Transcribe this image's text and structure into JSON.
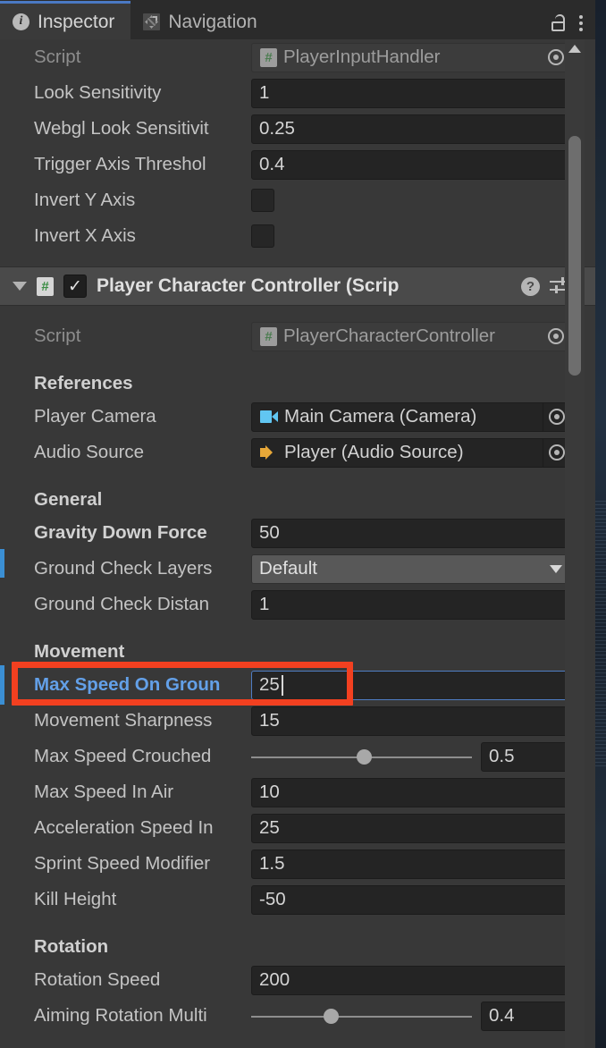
{
  "window": {
    "tabs": [
      {
        "label": "Inspector",
        "icon": "info-icon",
        "active": true
      },
      {
        "label": "Navigation",
        "icon": "navigation-move-icon",
        "active": false
      }
    ],
    "lock_icon": "unlock-icon",
    "menu_icon": "kebab-menu-icon",
    "accent_color": "#4a79c4"
  },
  "top_component": {
    "script_row": {
      "label": "Script",
      "value": "PlayerInputHandler",
      "icon": "csharp-script-icon"
    },
    "properties": [
      {
        "label": "Look Sensitivity",
        "value": "1",
        "type": "number"
      },
      {
        "label": "Webgl Look Sensitivit",
        "value": "0.25",
        "type": "number"
      },
      {
        "label": "Trigger Axis Threshol",
        "value": "0.4",
        "type": "number"
      },
      {
        "label": "Invert Y Axis",
        "value": "",
        "type": "checkbox",
        "checked": false
      },
      {
        "label": "Invert X Axis",
        "value": "",
        "type": "checkbox",
        "checked": false
      }
    ]
  },
  "component": {
    "title": "Player Character Controller (Scrip",
    "enabled": true,
    "enabled_glyph": "✓",
    "foldout_icon": "foldout-expanded-icon",
    "script_icon": "csharp-script-icon",
    "help_icon": "help-icon",
    "help_glyph": "?",
    "preset_icon": "preset-settings-icon",
    "menu_icon": "kebab-menu-icon",
    "script_row": {
      "label": "Script",
      "value": "PlayerCharacterController",
      "icon": "csharp-script-icon"
    },
    "sections": [
      {
        "title": "References",
        "rows": [
          {
            "label": "Player Camera",
            "value": "Main Camera (Camera)",
            "type": "object",
            "icon": "camera-icon"
          },
          {
            "label": "Audio Source",
            "value": "Player (Audio Source)",
            "type": "object",
            "icon": "audio-source-icon"
          }
        ]
      },
      {
        "title": "General",
        "rows": [
          {
            "label": "Gravity Down Force",
            "value": "50",
            "type": "number",
            "overridden": true,
            "bold": true
          },
          {
            "label": "Ground Check Layers",
            "value": "Default",
            "type": "dropdown"
          },
          {
            "label": "Ground Check Distan",
            "value": "1",
            "type": "number"
          }
        ]
      },
      {
        "title": "Movement",
        "rows": [
          {
            "label": "Max Speed On Groun",
            "value": "25",
            "type": "number",
            "overridden": true,
            "focused": true,
            "highlighted": true
          },
          {
            "label": "Movement Sharpness",
            "value": "15",
            "type": "number"
          },
          {
            "label": "Max Speed Crouched",
            "value": "0.5",
            "type": "slider",
            "slider_pct": 51
          },
          {
            "label": "Max Speed In Air",
            "value": "10",
            "type": "number"
          },
          {
            "label": "Acceleration Speed In",
            "value": "25",
            "type": "number"
          },
          {
            "label": "Sprint Speed Modifier",
            "value": "1.5",
            "type": "number"
          },
          {
            "label": "Kill Height",
            "value": "-50",
            "type": "number"
          }
        ]
      },
      {
        "title": "Rotation",
        "rows": [
          {
            "label": "Rotation Speed",
            "value": "200",
            "type": "number"
          },
          {
            "label": "Aiming Rotation Multi",
            "value": "0.4",
            "type": "slider",
            "slider_pct": 36
          }
        ]
      }
    ]
  },
  "scrollbar": {
    "up_arrow": "scroll-up-arrow-icon"
  },
  "annotation": {
    "color": "#f24020",
    "target": "Max Speed On Groun"
  }
}
